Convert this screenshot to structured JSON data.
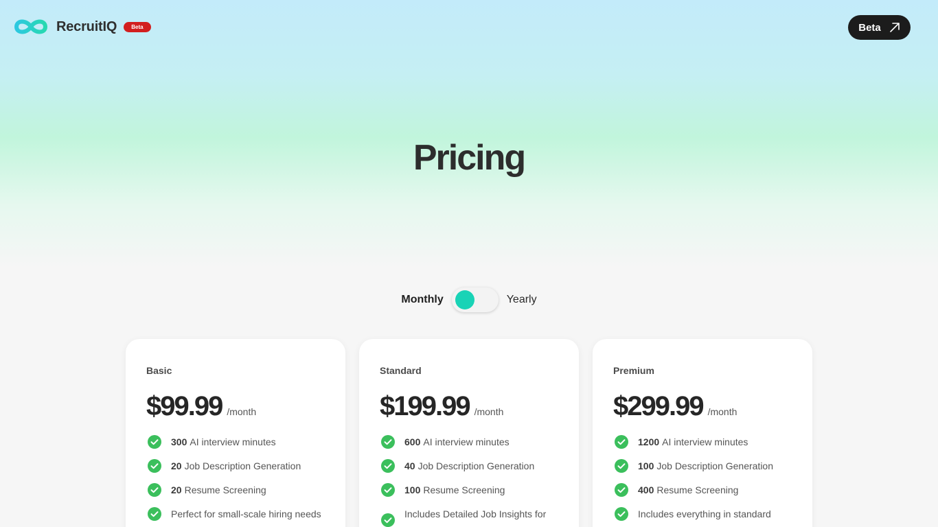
{
  "header": {
    "brand": "RecruitIQ",
    "badge": "Beta",
    "cta_label": "Beta",
    "accent_color": "#19d3b6",
    "badge_color": "#d21f1f"
  },
  "page": {
    "title": "Pricing"
  },
  "billing_toggle": {
    "left_label": "Monthly",
    "right_label": "Yearly",
    "selected": "Monthly"
  },
  "plans": [
    {
      "name": "Basic",
      "price": "$99.99",
      "period": "/month",
      "features": [
        {
          "num": "300",
          "text": "AI interview minutes"
        },
        {
          "num": "20",
          "text": "Job Description Generation"
        },
        {
          "num": "20",
          "text": "Resume Screening"
        },
        {
          "num": "",
          "text": "Perfect for small-scale hiring needs"
        }
      ]
    },
    {
      "name": "Standard",
      "price": "$199.99",
      "period": "/month",
      "features": [
        {
          "num": "600",
          "text": "AI interview minutes"
        },
        {
          "num": "40",
          "text": "Job Description Generation"
        },
        {
          "num": "100",
          "text": "Resume Screening"
        },
        {
          "num": "",
          "text": "Includes Detailed Job Insights for"
        }
      ]
    },
    {
      "name": "Premium",
      "price": "$299.99",
      "period": "/month",
      "features": [
        {
          "num": "1200",
          "text": "AI interview minutes"
        },
        {
          "num": "100",
          "text": "Job Description Generation"
        },
        {
          "num": "400",
          "text": "Resume Screening"
        },
        {
          "num": "",
          "text": "Includes everything in standard"
        }
      ]
    }
  ]
}
